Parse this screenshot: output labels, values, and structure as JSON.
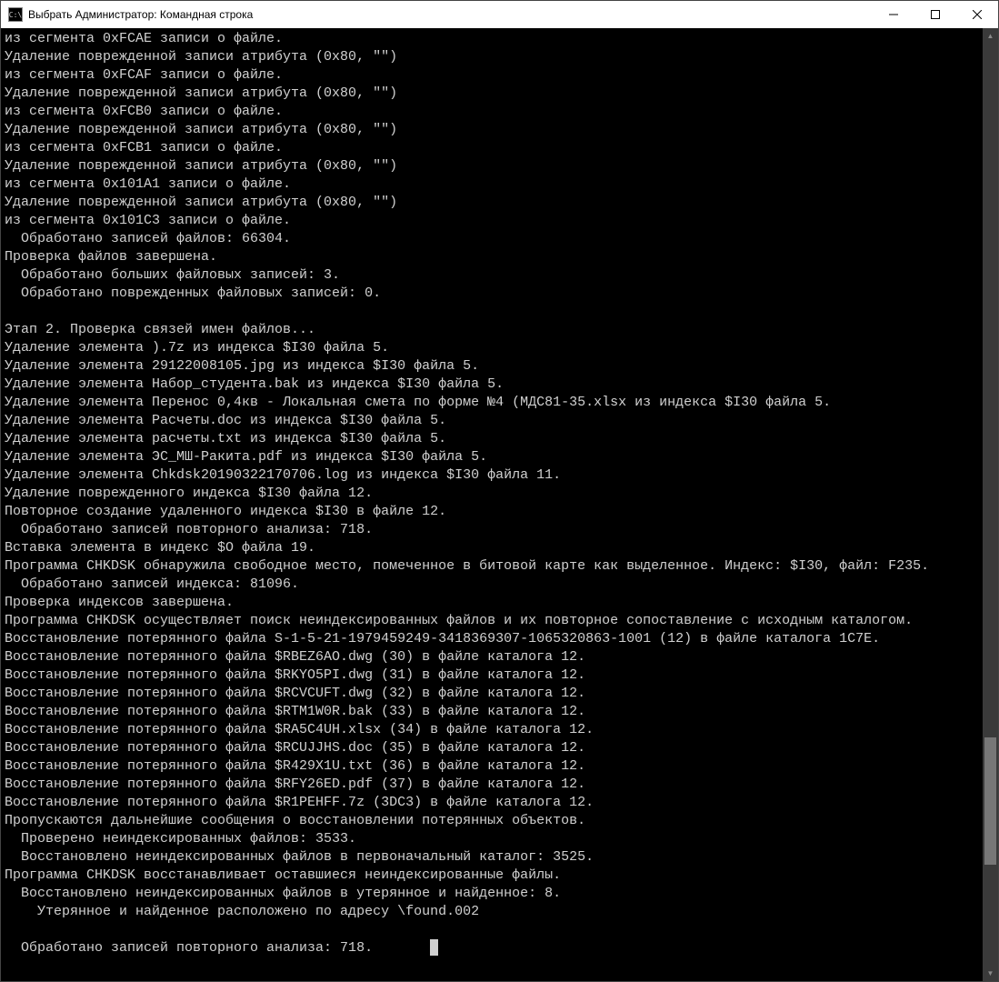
{
  "window": {
    "title": "Выбрать Администратор: Командная строка",
    "iconGlyph": "C:\\"
  },
  "console": {
    "lines": [
      "из сегмента 0xFCAE записи о файле.",
      "Удаление поврежденной записи атрибута (0x80, \"\")",
      "из сегмента 0xFCAF записи о файле.",
      "Удаление поврежденной записи атрибута (0x80, \"\")",
      "из сегмента 0xFCB0 записи о файле.",
      "Удаление поврежденной записи атрибута (0x80, \"\")",
      "из сегмента 0xFCB1 записи о файле.",
      "Удаление поврежденной записи атрибута (0x80, \"\")",
      "из сегмента 0x101A1 записи о файле.",
      "Удаление поврежденной записи атрибута (0x80, \"\")",
      "из сегмента 0x101C3 записи о файле.",
      "  Обработано записей файлов: 66304.",
      "Проверка файлов завершена.",
      "  Обработано больших файловых записей: 3.",
      "  Обработано поврежденных файловых записей: 0.",
      "",
      "Этап 2. Проверка связей имен файлов...",
      "Удаление элемента ).7z из индекса $I30 файла 5.",
      "Удаление элемента 29122008105.jpg из индекса $I30 файла 5.",
      "Удаление элемента Набор_студента.bak из индекса $I30 файла 5.",
      "Удаление элемента Перенос 0,4кв - Локальная смета по форме №4 (МДС81-35.xlsx из индекса $I30 файла 5.",
      "Удаление элемента Расчеты.doc из индекса $I30 файла 5.",
      "Удаление элемента расчеты.txt из индекса $I30 файла 5.",
      "Удаление элемента ЭС_МШ-Ракита.pdf из индекса $I30 файла 5.",
      "Удаление элемента Chkdsk20190322170706.log из индекса $I30 файла 11.",
      "Удаление поврежденного индекса $I30 файла 12.",
      "Повторное создание удаленного индекса $I30 в файле 12.",
      "  Обработано записей повторного анализа: 718.",
      "Вставка элемента в индекс $O файла 19.",
      "Программа CHKDSK обнаружила свободное место, помеченное в битовой карте как выделенное. Индекс: $I30, файл: F235.",
      "  Обработано записей индекса: 81096.",
      "Проверка индексов завершена.",
      "Программа CHKDSK осуществляет поиск неиндексированных файлов и их повторное сопоставление с исходным каталогом.",
      "Восстановление потерянного файла S-1-5-21-1979459249-3418369307-1065320863-1001 (12) в файле каталога 1C7E.",
      "Восстановление потерянного файла $RBEZ6AO.dwg (30) в файле каталога 12.",
      "Восстановление потерянного файла $RKYO5PI.dwg (31) в файле каталога 12.",
      "Восстановление потерянного файла $RCVCUFT.dwg (32) в файле каталога 12.",
      "Восстановление потерянного файла $RTM1W0R.bak (33) в файле каталога 12.",
      "Восстановление потерянного файла $RA5C4UH.xlsx (34) в файле каталога 12.",
      "Восстановление потерянного файла $RCUJJHS.doc (35) в файле каталога 12.",
      "Восстановление потерянного файла $R429X1U.txt (36) в файле каталога 12.",
      "Восстановление потерянного файла $RFY26ED.pdf (37) в файле каталога 12.",
      "Восстановление потерянного файла $R1PEHFF.7z (3DC3) в файле каталога 12.",
      "Пропускаются дальнейшие сообщения о восстановлении потерянных объектов.",
      "  Проверено неиндексированных файлов: 3533.",
      "  Восстановлено неиндексированных файлов в первоначальный каталог: 3525.",
      "Программа CHKDSK восстанавливает оставшиеся неиндексированные файлы.",
      "  Восстановлено неиндексированных файлов в утерянное и найденное: 8.",
      "    Утерянное и найденное расположено по адресу \\found.002",
      "",
      "  Обработано записей повторного анализа: 718."
    ]
  }
}
